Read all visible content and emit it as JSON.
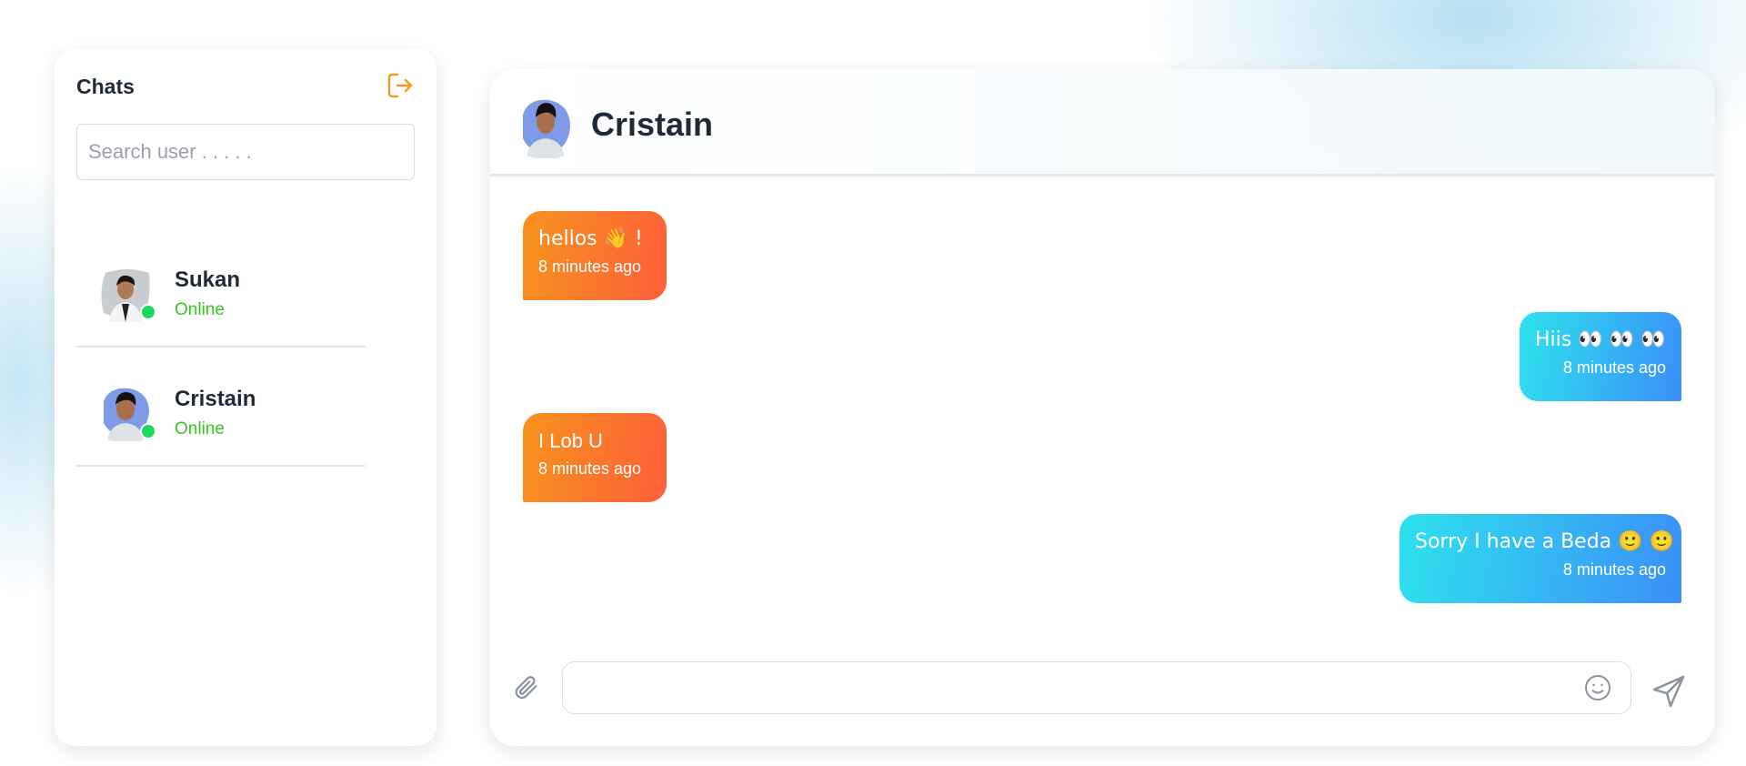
{
  "sidebar": {
    "title": "Chats",
    "search_placeholder": "Search user . . . . .",
    "users": [
      {
        "name": "Sukan",
        "status": "Online"
      },
      {
        "name": "Cristain",
        "status": "Online"
      }
    ]
  },
  "chat": {
    "contact_name": "Cristain",
    "messages": [
      {
        "side": "left",
        "text": "hellos 👋 !",
        "time": "8 minutes ago"
      },
      {
        "side": "right",
        "text": "Hiis 👀 👀 👀",
        "time": "8 minutes ago"
      },
      {
        "side": "left",
        "text": "I Lob U",
        "time": "8 minutes ago"
      },
      {
        "side": "right",
        "text": "Sorry I have a Beda 🙂 🙂",
        "time": "8 minutes ago"
      }
    ],
    "input_value": "",
    "icons": [
      "paperclip-icon",
      "smiley-icon",
      "send-icon"
    ]
  },
  "colors": {
    "accent_orange": "#f7931e",
    "online_green": "#34c71f",
    "bubble_left_start": "#f7931e",
    "bubble_left_end": "#fd5f3a",
    "bubble_right_start": "#2ee2ee",
    "bubble_right_end": "#3b8ff7"
  }
}
